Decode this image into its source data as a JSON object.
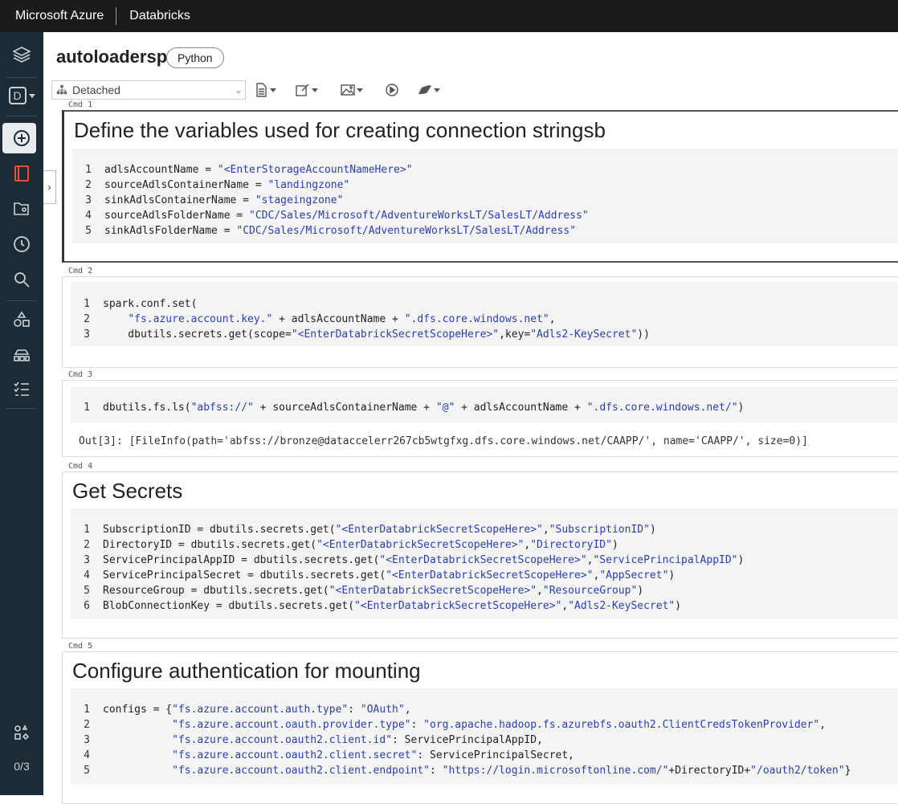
{
  "topbar": {
    "brand": "Microsoft Azure",
    "product": "Databricks"
  },
  "sidebar": {
    "icons": [
      "layers-icon",
      "workspace-d-icon",
      "create-plus-icon",
      "notebook-icon",
      "repos-icon",
      "recents-icon",
      "search-icon",
      "shapes-icon",
      "cluster-icon",
      "jobs-icon",
      "settings-icon"
    ],
    "workspace_letter": "D",
    "progress": "0/3"
  },
  "notebook": {
    "title": "autoloadersp",
    "language": "Python"
  },
  "toolbar": {
    "cluster": "Detached"
  },
  "cells": [
    {
      "cmd": "Cmd 1",
      "title": "Define the variables used for creating connection stringsb",
      "lines": [
        [
          [
            "adlsAccountName = ",
            "p"
          ],
          [
            "\"<EnterStorageAccountNameHere>\"",
            "s"
          ]
        ],
        [
          [
            "sourceAdlsContainerName = ",
            "p"
          ],
          [
            "\"landingzone\"",
            "s"
          ]
        ],
        [
          [
            "sinkAdlsContainerName = ",
            "p"
          ],
          [
            "\"stageingzone\"",
            "s"
          ]
        ],
        [
          [
            "sourceAdlsFolderName = ",
            "p"
          ],
          [
            "\"CDC/Sales/Microsoft/AdventureWorksLT/SalesLT/Address\"",
            "s"
          ]
        ],
        [
          [
            "sinkAdlsFolderName = ",
            "p"
          ],
          [
            "\"CDC/Sales/Microsoft/AdventureWorksLT/SalesLT/Address\"",
            "s"
          ]
        ]
      ]
    },
    {
      "cmd": "Cmd 2",
      "lines": [
        [
          [
            "spark.conf.set(",
            "p"
          ]
        ],
        [
          [
            "    ",
            "p"
          ],
          [
            "\"fs.azure.account.key.\"",
            "s"
          ],
          [
            " + adlsAccountName + ",
            "p"
          ],
          [
            "\".dfs.core.windows.net\"",
            "s"
          ],
          [
            ",",
            "p"
          ]
        ],
        [
          [
            "    dbutils.secrets.get(scope=",
            "p"
          ],
          [
            "\"<EnterDatabrickSecretScopeHere>\"",
            "s"
          ],
          [
            ",key=",
            "p"
          ],
          [
            "\"Adls2-KeySecret\"",
            "s"
          ],
          [
            "))",
            "p"
          ]
        ]
      ]
    },
    {
      "cmd": "Cmd 3",
      "lines": [
        [
          [
            "dbutils.fs.ls(",
            "p"
          ],
          [
            "\"abfss://\"",
            "s"
          ],
          [
            " + sourceAdlsContainerName + ",
            "p"
          ],
          [
            "\"@\"",
            "s"
          ],
          [
            " + adlsAccountName + ",
            "p"
          ],
          [
            "\".dfs.core.windows.net/\"",
            "s"
          ],
          [
            ")",
            "p"
          ]
        ]
      ],
      "output": "Out[3]: [FileInfo(path='abfss://bronze@dataccelerr267cb5wtgfxg.dfs.core.windows.net/CAAPP/', name='CAAPP/', size=0)]"
    },
    {
      "cmd": "Cmd 4",
      "title": "Get Secrets",
      "lines": [
        [
          [
            "SubscriptionID = dbutils.secrets.get(",
            "p"
          ],
          [
            "\"<EnterDatabrickSecretScopeHere>\"",
            "s"
          ],
          [
            ",",
            "p"
          ],
          [
            "\"SubscriptionID\"",
            "s"
          ],
          [
            ")",
            "p"
          ]
        ],
        [
          [
            "DirectoryID = dbutils.secrets.get(",
            "p"
          ],
          [
            "\"<EnterDatabrickSecretScopeHere>\"",
            "s"
          ],
          [
            ",",
            "p"
          ],
          [
            "\"DirectoryID\"",
            "s"
          ],
          [
            ")",
            "p"
          ]
        ],
        [
          [
            "ServicePrincipalAppID = dbutils.secrets.get(",
            "p"
          ],
          [
            "\"<EnterDatabrickSecretScopeHere>\"",
            "s"
          ],
          [
            ",",
            "p"
          ],
          [
            "\"ServicePrincipalAppID\"",
            "s"
          ],
          [
            ")",
            "p"
          ]
        ],
        [
          [
            "ServicePrincipalSecret = dbutils.secrets.get(",
            "p"
          ],
          [
            "\"<EnterDatabrickSecretScopeHere>\"",
            "s"
          ],
          [
            ",",
            "p"
          ],
          [
            "\"AppSecret\"",
            "s"
          ],
          [
            ")",
            "p"
          ]
        ],
        [
          [
            "ResourceGroup = dbutils.secrets.get(",
            "p"
          ],
          [
            "\"<EnterDatabrickSecretScopeHere>\"",
            "s"
          ],
          [
            ",",
            "p"
          ],
          [
            "\"ResourceGroup\"",
            "s"
          ],
          [
            ")",
            "p"
          ]
        ],
        [
          [
            "BlobConnectionKey = dbutils.secrets.get(",
            "p"
          ],
          [
            "\"<EnterDatabrickSecretScopeHere>\"",
            "s"
          ],
          [
            ",",
            "p"
          ],
          [
            "\"Adls2-KeySecret\"",
            "s"
          ],
          [
            ")",
            "p"
          ]
        ]
      ]
    },
    {
      "cmd": "Cmd 5",
      "title": "Configure authentication for mounting",
      "lines": [
        [
          [
            "configs = {",
            "p"
          ],
          [
            "\"fs.azure.account.auth.type\"",
            "s"
          ],
          [
            ": ",
            "p"
          ],
          [
            "\"OAuth\"",
            "s"
          ],
          [
            ",",
            "p"
          ]
        ],
        [
          [
            "           ",
            "p"
          ],
          [
            "\"fs.azure.account.oauth.provider.type\"",
            "s"
          ],
          [
            ": ",
            "p"
          ],
          [
            "\"org.apache.hadoop.fs.azurebfs.oauth2.ClientCredsTokenProvider\"",
            "s"
          ],
          [
            ",",
            "p"
          ]
        ],
        [
          [
            "           ",
            "p"
          ],
          [
            "\"fs.azure.account.oauth2.client.id\"",
            "s"
          ],
          [
            ": ServicePrincipalAppID,",
            "p"
          ]
        ],
        [
          [
            "           ",
            "p"
          ],
          [
            "\"fs.azure.account.oauth2.client.secret\"",
            "s"
          ],
          [
            ": ServicePrincipalSecret,",
            "p"
          ]
        ],
        [
          [
            "           ",
            "p"
          ],
          [
            "\"fs.azure.account.oauth2.client.endpoint\"",
            "s"
          ],
          [
            ": ",
            "p"
          ],
          [
            "\"https://login.microsoftonline.com/\"",
            "s"
          ],
          [
            "+DirectoryID+",
            "p"
          ],
          [
            "\"/oauth2/token\"",
            "s"
          ],
          [
            "}",
            "p"
          ]
        ]
      ]
    }
  ]
}
